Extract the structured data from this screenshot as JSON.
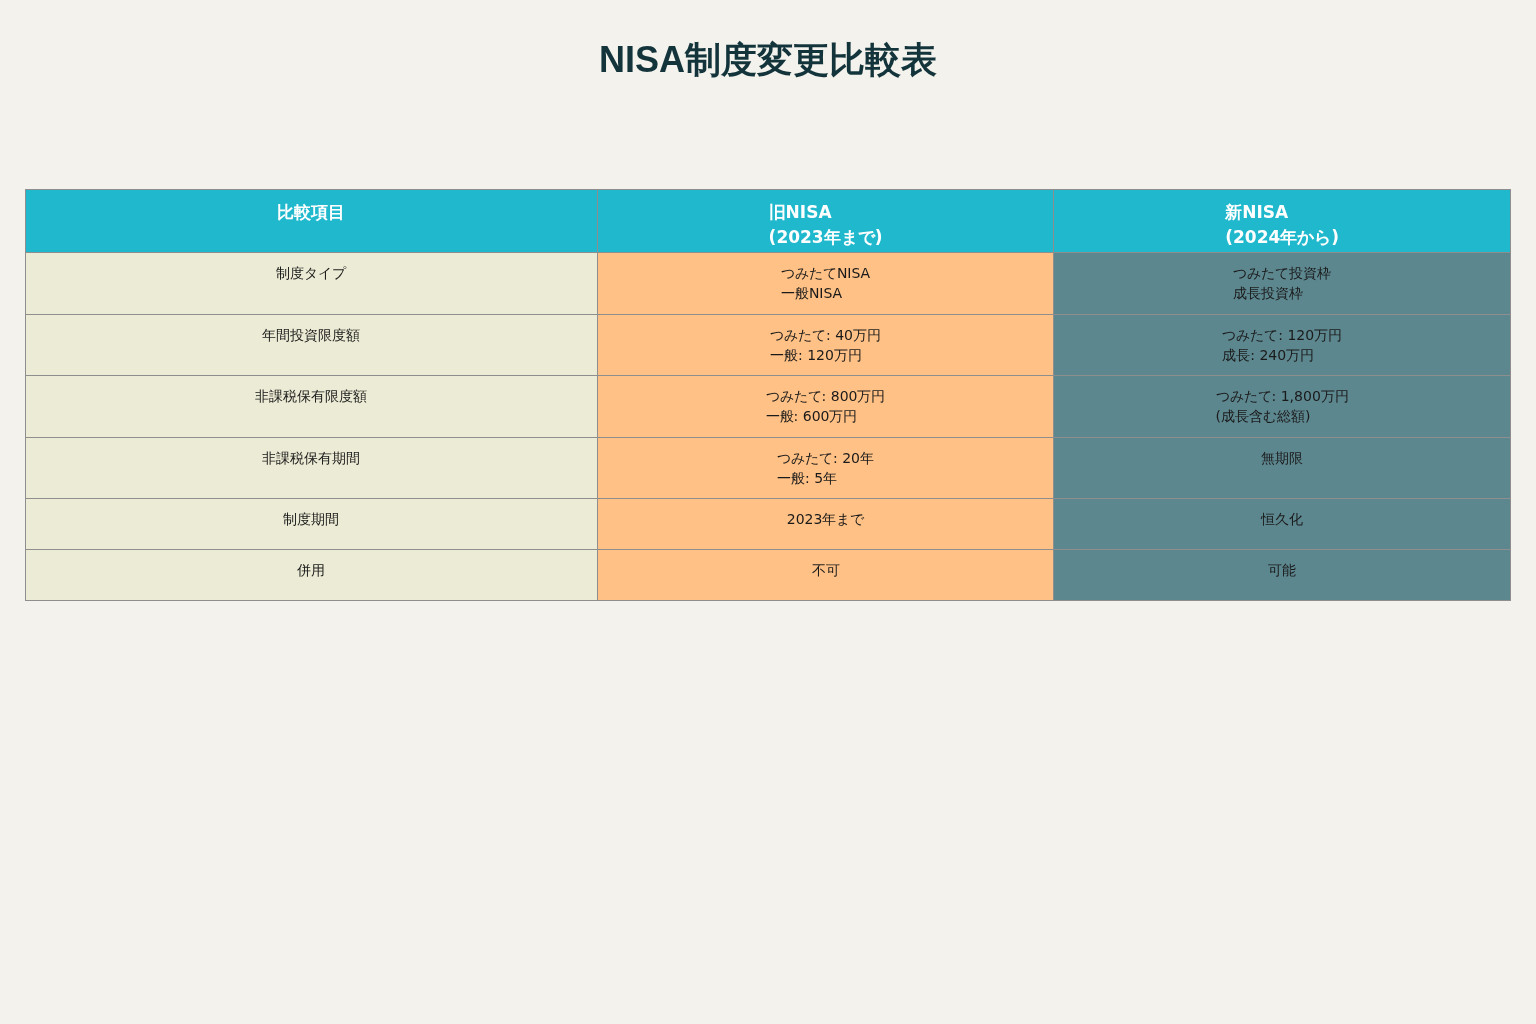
{
  "title": "NISA制度変更比較表",
  "table": {
    "columns": [
      {
        "lines": [
          "比較項目"
        ]
      },
      {
        "lines": [
          "旧NISA",
          "(2023年まで)"
        ]
      },
      {
        "lines": [
          "新NISA",
          "(2024年から)"
        ]
      }
    ],
    "rows": [
      {
        "cells": [
          [
            "制度タイプ"
          ],
          [
            "つみたてNISA",
            "一般NISA"
          ],
          [
            "つみたて投資枠",
            "成長投資枠"
          ]
        ]
      },
      {
        "cells": [
          [
            "年間投資限度額"
          ],
          [
            "つみたて: 40万円",
            "一般: 120万円"
          ],
          [
            "つみたて: 120万円",
            "成長: 240万円"
          ]
        ]
      },
      {
        "cells": [
          [
            "非課税保有限度額"
          ],
          [
            "つみたて: 800万円",
            "一般: 600万円"
          ],
          [
            "つみたて: 1,800万円",
            "(成長含む総額)"
          ]
        ]
      },
      {
        "cells": [
          [
            "非課税保有期間"
          ],
          [
            "つみたて: 20年",
            "一般: 5年"
          ],
          [
            "無期限"
          ]
        ]
      },
      {
        "cells": [
          [
            "制度期間"
          ],
          [
            "2023年まで"
          ],
          [
            "恒久化"
          ]
        ]
      },
      {
        "cells": [
          [
            "併用"
          ],
          [
            "不可"
          ],
          [
            "可能"
          ]
        ]
      }
    ]
  }
}
